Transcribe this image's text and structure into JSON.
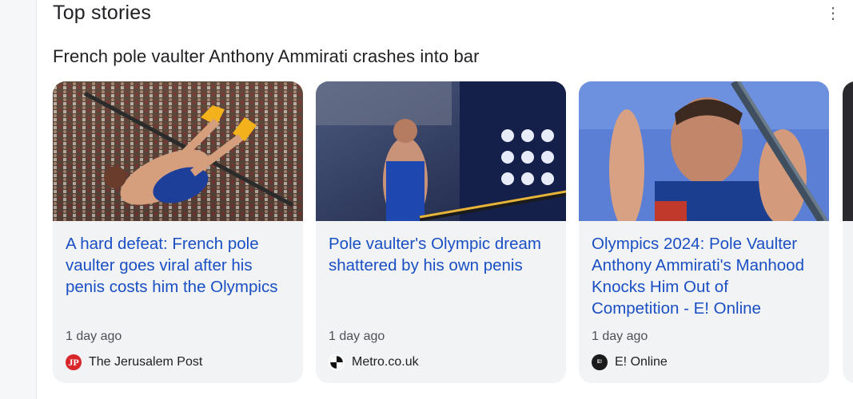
{
  "section": {
    "title": "Top stories",
    "more_icon": "more-vert-icon"
  },
  "story_heading": "French pole vaulter Anthony Ammirati crashes into bar",
  "cards": [
    {
      "headline": "A hard defeat: French pole vaulter goes viral after his penis costs him the Olympics",
      "time": "1 day ago",
      "source": "The Jerusalem Post",
      "source_icon_text": "JP"
    },
    {
      "headline": "Pole vaulter's Olympic dream shattered by his own penis",
      "time": "1 day ago",
      "source": "Metro.co.uk"
    },
    {
      "headline": "Olympics 2024: Pole Vaulter Anthony Ammirati's Manhood Knocks Him Out of Competition - E! Online",
      "time": "1 day ago",
      "source": "E! Online",
      "source_icon_text": "E!"
    }
  ],
  "colors": {
    "headline": "#1a4fc4",
    "card_bg": "#f1f3f4",
    "jp_red": "#d8262b"
  }
}
